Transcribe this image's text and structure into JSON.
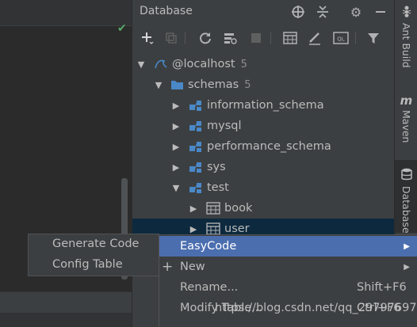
{
  "database_window": {
    "title": "Database",
    "header_icons": [
      "target-icon",
      "collapse-icon",
      "gear-icon",
      "minimize-icon"
    ],
    "toolbar_icons": [
      "add-icon",
      "copy-icon",
      "refresh-icon",
      "settings-icon",
      "stop-icon",
      "table-icon",
      "edit-icon",
      "sql-console-icon",
      "filter-icon"
    ]
  },
  "tree": {
    "connection": {
      "label": "@localhost",
      "count": "5"
    },
    "schemas": {
      "label": "schemas",
      "count": "5"
    },
    "databases": [
      "information_schema",
      "mysql",
      "performance_schema",
      "sys",
      "test"
    ],
    "tables": [
      "book",
      "user"
    ]
  },
  "right_sidebar": {
    "tabs": [
      {
        "label": "Ant Build",
        "icon": "ant-icon"
      },
      {
        "label": "Maven",
        "icon": "maven-icon"
      },
      {
        "label": "Database",
        "icon": "database-icon"
      }
    ]
  },
  "submenu": {
    "items": [
      "Generate Code",
      "Config Table"
    ]
  },
  "context_menu": {
    "items": [
      {
        "label": "EasyCode",
        "shortcut": "",
        "submenu": true
      },
      {
        "label": "New",
        "shortcut": "",
        "submenu": true
      },
      {
        "label": "Rename...",
        "shortcut": "Shift+F6",
        "submenu": false
      },
      {
        "label": "Modify Table...",
        "shortcut": "Ctrl+F6",
        "submenu": false
      }
    ]
  },
  "watermark": "https://blog.csdn.net/qq_29797697",
  "colors": {
    "highlight": "#4b6eaf",
    "selected_row": "#0d293e",
    "panel": "#3c3f41",
    "editor": "#2b2b2b",
    "folder": "#4a88c7"
  }
}
